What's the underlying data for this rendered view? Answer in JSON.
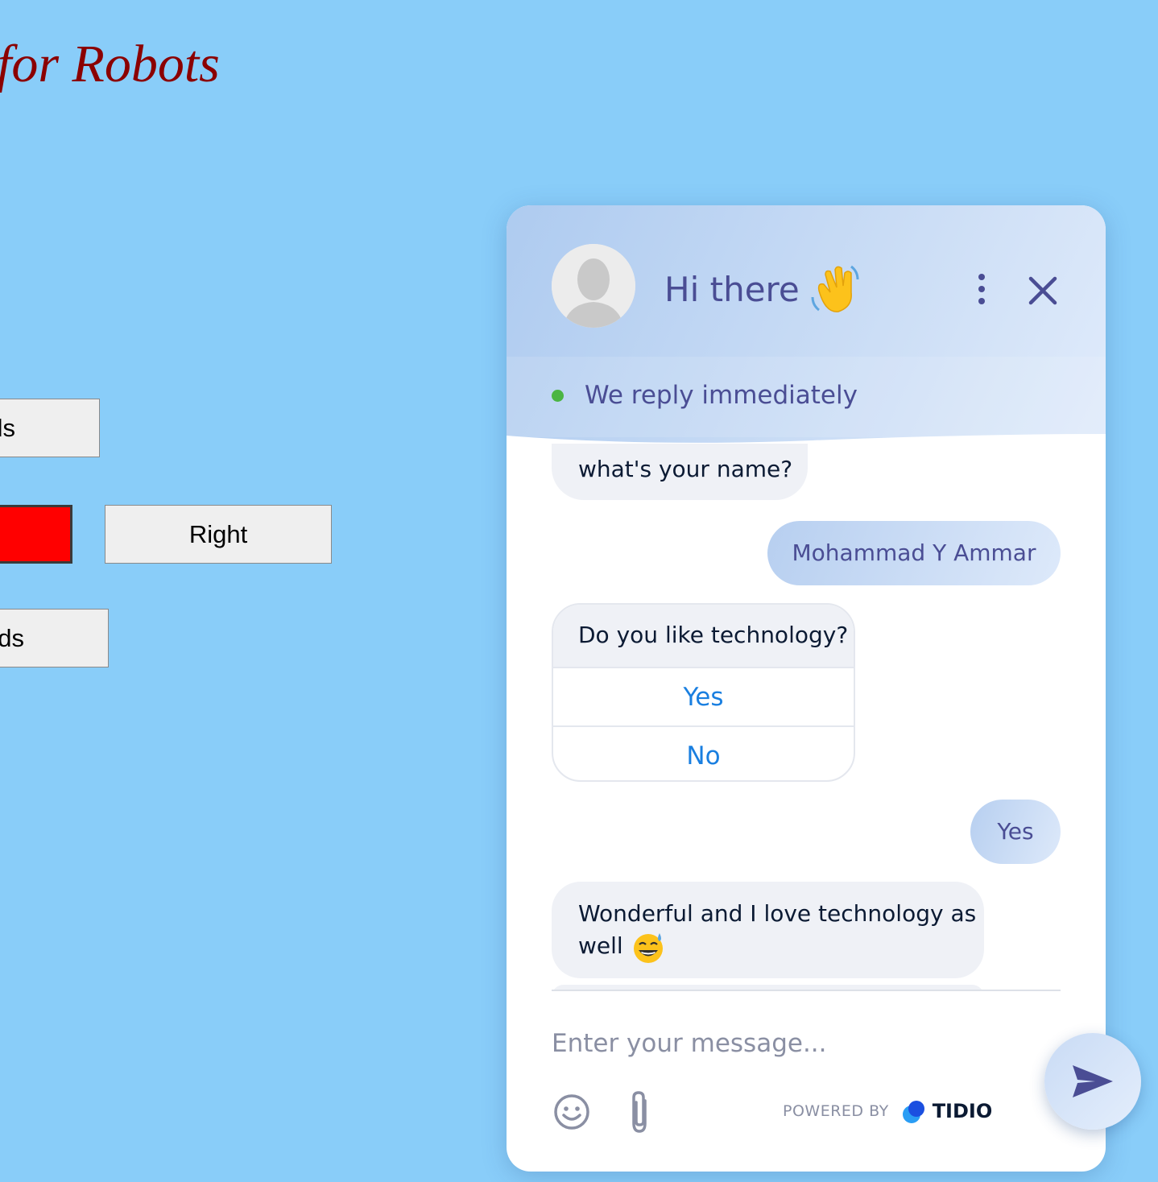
{
  "page": {
    "title": "for Robots",
    "buttons": {
      "forward_label": "Forwards",
      "left_label": "",
      "right_label": "Right",
      "backward_label": "Backwards"
    }
  },
  "chat": {
    "header_title": "Hi there",
    "status_text": "We reply immediately",
    "messages": [
      {
        "from": "operator",
        "text": "what's your name?"
      },
      {
        "from": "visitor",
        "text": "Mohammad Y Ammar"
      },
      {
        "from": "operator",
        "text": "Do you like technology?",
        "options": [
          "Yes",
          "No"
        ]
      },
      {
        "from": "visitor",
        "text": "Yes"
      },
      {
        "from": "operator",
        "text": "Wonderful and I love technology as well"
      }
    ],
    "input_placeholder": "Enter your message...",
    "powered_by": "POWERED BY",
    "brand": "TIDIO",
    "icons": [
      "avatar",
      "waving-hand-icon",
      "kebab-menu-icon",
      "close-icon",
      "emoji-icon",
      "paperclip-icon",
      "send-icon",
      "sweat-smile-emoji",
      "tidio-logo"
    ],
    "colors": {
      "accent": "#4a4d94",
      "link": "#1a7fe0",
      "online": "#4bb543"
    }
  }
}
